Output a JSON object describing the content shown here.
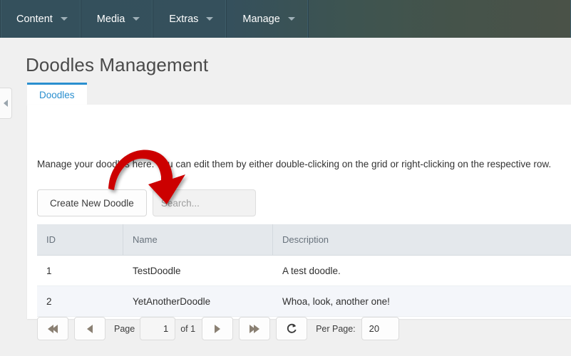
{
  "navbar": {
    "items": [
      {
        "label": "Content",
        "icon": "chevron-down-icon"
      },
      {
        "label": "Media",
        "icon": "chevron-down-icon"
      },
      {
        "label": "Extras",
        "icon": "chevron-down-icon"
      },
      {
        "label": "Manage",
        "icon": "chevron-down-icon"
      }
    ],
    "gradient_from": "#34505c",
    "gradient_to": "#4a5248",
    "text_color": "#ffffff"
  },
  "page": {
    "title": "Doodles Management",
    "background": "#f0f0f0"
  },
  "collapse_handle": {
    "icon": "chevron-left-icon"
  },
  "tabs": [
    {
      "label": "Doodles",
      "active": true,
      "accent": "#2a8fcf"
    }
  ],
  "panel": {
    "description": "Manage your doodles here. You can edit them by either double-clicking on the grid or right-clicking on the respective row."
  },
  "toolbar": {
    "create_label": "Create New Doodle",
    "search_placeholder": "Search...",
    "search_value": ""
  },
  "grid": {
    "columns": [
      {
        "key": "id",
        "label": "ID"
      },
      {
        "key": "name",
        "label": "Name"
      },
      {
        "key": "desc",
        "label": "Description"
      }
    ],
    "rows": [
      {
        "id": "1",
        "name": "TestDoodle",
        "desc": "A test doodle."
      },
      {
        "id": "2",
        "name": "YetAnotherDoodle",
        "desc": "Whoa, look, another one!"
      }
    ]
  },
  "pager": {
    "first_icon": "double-chevron-left-icon",
    "prev_icon": "chevron-left-icon",
    "page_label": "Page",
    "page_value": "1",
    "of_label": "of 1",
    "next_icon": "chevron-right-icon",
    "last_icon": "double-chevron-right-icon",
    "refresh_icon": "refresh-icon",
    "per_page_label": "Per Page:",
    "per_page_value": "20"
  },
  "annotation": {
    "arrow_color": "#cc0000",
    "points_to": "search-input"
  }
}
